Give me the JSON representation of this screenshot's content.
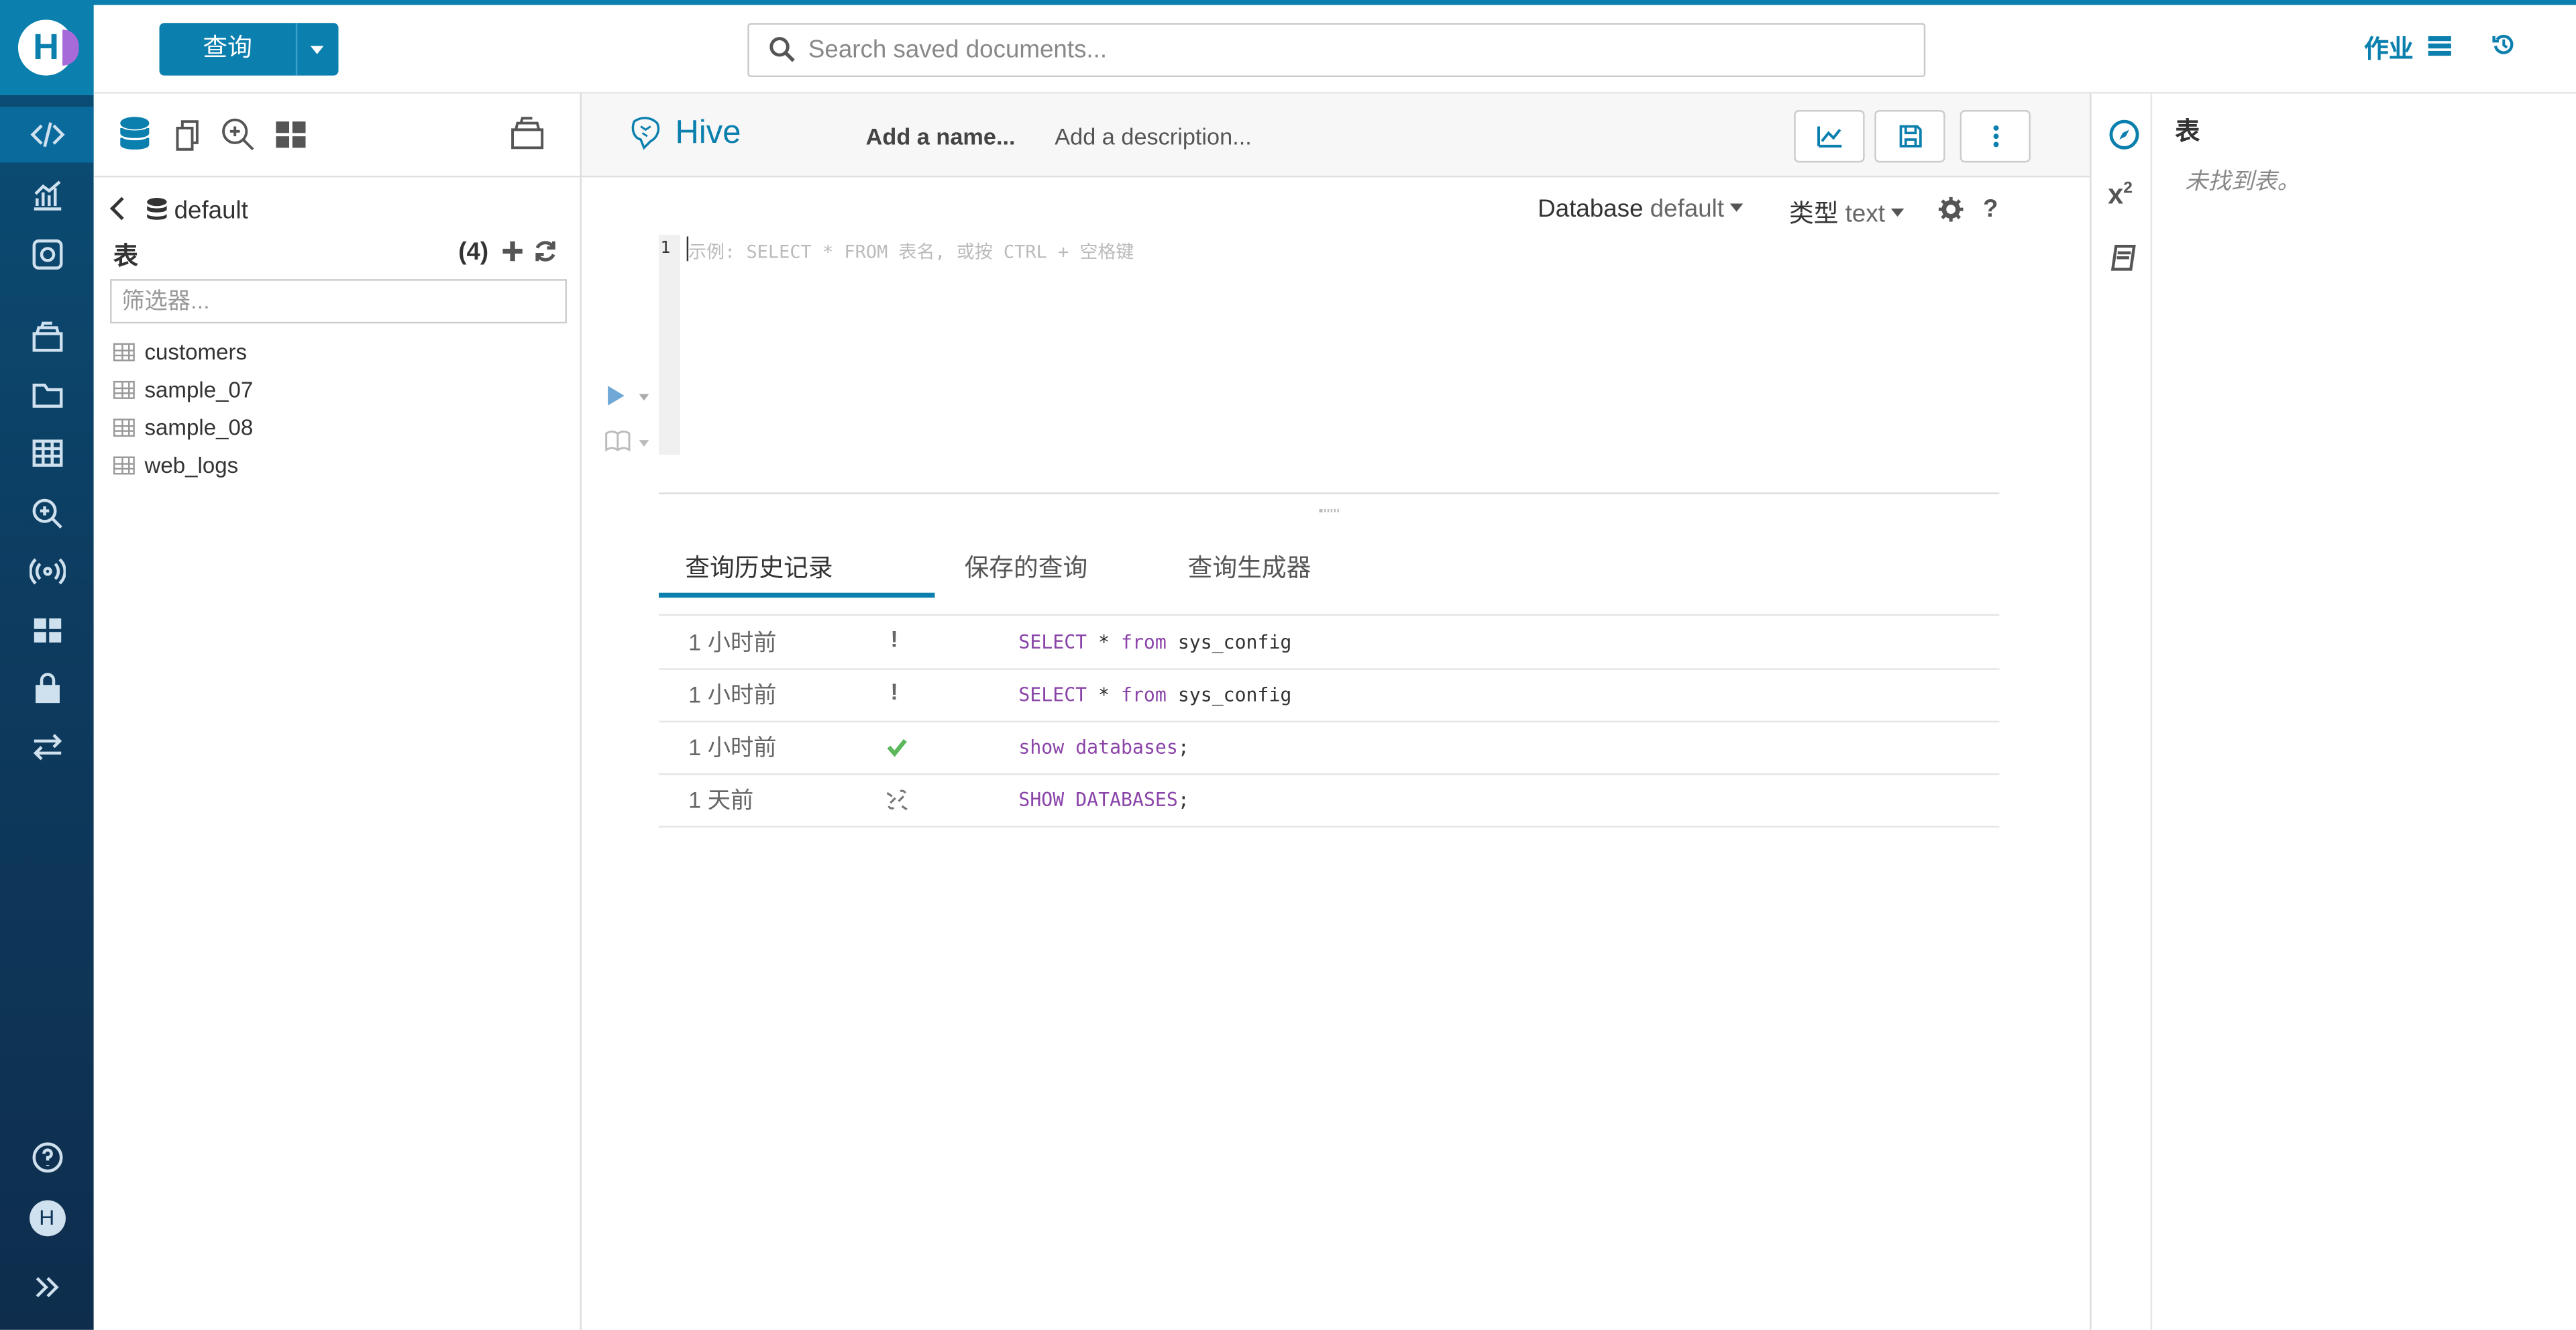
{
  "topbar": {
    "query_button": "查询",
    "search_placeholder": "Search saved documents...",
    "jobs_label": "作业"
  },
  "nav": {
    "items": [
      "editor",
      "dashboard",
      "scheduler",
      "documents",
      "files",
      "tables",
      "jobs-browser",
      "streams",
      "apps",
      "security",
      "importer"
    ],
    "bottom": [
      "help",
      "user",
      "expand"
    ],
    "user_initial": "H"
  },
  "assist": {
    "database": "default",
    "tables_heading": "表",
    "tables_count": "(4)",
    "filter_placeholder": "筛选器...",
    "tables": [
      "customers",
      "sample_07",
      "sample_08",
      "web_logs"
    ]
  },
  "editor": {
    "engine": "Hive",
    "add_name": "Add a name...",
    "add_description": "Add a description...",
    "database_label": "Database",
    "database_value": "default",
    "type_label": "类型",
    "type_value": "text",
    "line_number": "1",
    "placeholder": "示例: SELECT * FROM 表名, 或按 CTRL + 空格键",
    "resize_handle": "···"
  },
  "tabs": [
    "查询历史记录",
    "保存的查询",
    "查询生成器"
  ],
  "history": [
    {
      "time": "1 小时前",
      "status": "error",
      "sql_kw1": "SELECT",
      "sql_mid": " * ",
      "sql_kw2": "from",
      "sql_rest": " sys_config"
    },
    {
      "time": "1 小时前",
      "status": "error",
      "sql_kw1": "SELECT",
      "sql_mid": " * ",
      "sql_kw2": "from",
      "sql_rest": " sys_config"
    },
    {
      "time": "1 小时前",
      "status": "success",
      "sql_kw1": "show",
      "sql_mid": " ",
      "sql_kw2": "databases",
      "sql_rest": ";"
    },
    {
      "time": "1 天前",
      "status": "expired",
      "sql_kw1": "SHOW",
      "sql_mid": " ",
      "sql_kw2": "DATABASES",
      "sql_rest": ";"
    }
  ],
  "right_panel": {
    "title": "表",
    "empty_text": "未找到表。"
  },
  "colors": {
    "accent": "#0b7fad",
    "nav_top": "#0a4f78",
    "nav_bottom": "#0e2d4d",
    "keyword": "#8a44a8",
    "success": "#5cb85c"
  }
}
